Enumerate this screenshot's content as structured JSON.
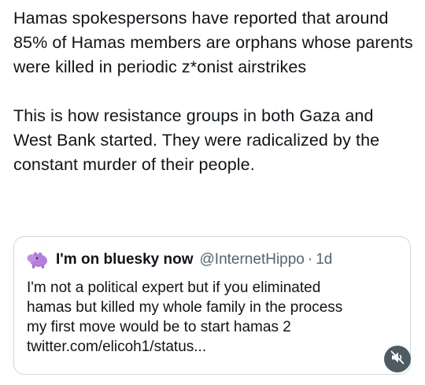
{
  "post": {
    "paragraphs": [
      "Hamas spokespersons have reported that around 85% of Hamas members are orphans whose parents were killed in periodic z*onist airstrikes",
      "This is how resistance groups in both Gaza and West Bank started. They were radicalized by the constant murder of their people."
    ]
  },
  "quoted_post": {
    "display_name": "I'm on bluesky now",
    "handle": "@InternetHippo",
    "separator": "·",
    "time": "1d",
    "avatar_icon": "hippo-avatar-icon",
    "text_lines": [
      "I'm not a political expert but if you eliminated",
      "hamas but killed my whole family in the process",
      "my first move would be to start hamas 2",
      "twitter.com/elicoh1/status..."
    ]
  },
  "controls": {
    "mute_icon": "speaker-muted-icon"
  },
  "colors": {
    "text": "#0f1419",
    "secondary_text": "#536471",
    "border": "#cfd9de",
    "avatar": "#b47fdb",
    "mute_button_bg": "#4f5b62"
  }
}
